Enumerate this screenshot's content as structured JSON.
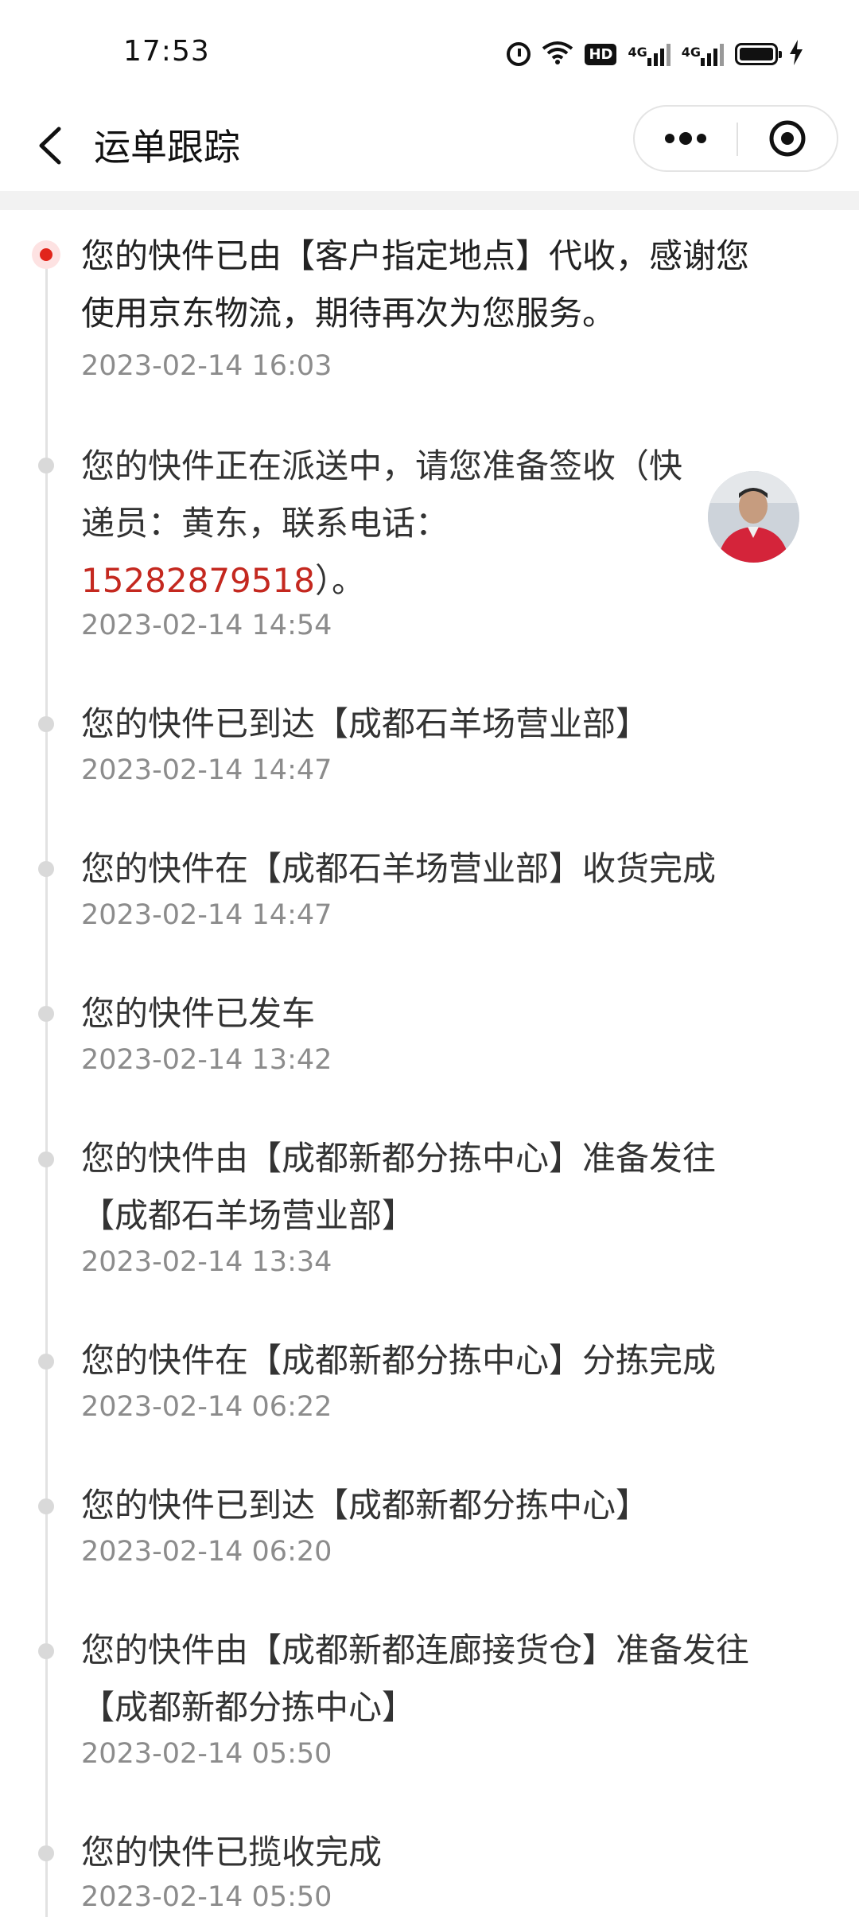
{
  "status_bar": {
    "time": "17:53",
    "hd_label": "HD",
    "network_1": "4G",
    "network_2": "4G",
    "icons": [
      "alarm-icon",
      "wifi-icon",
      "hd-badge",
      "signal-icon",
      "signal-icon",
      "battery-icon",
      "charging-icon"
    ]
  },
  "header": {
    "title": "运单跟踪",
    "more_icon": "more-dots-icon",
    "close_icon": "mini-program-close-icon"
  },
  "colors": {
    "accent": "#e1251b",
    "phone": "#c4281f",
    "text": "#333333",
    "time": "#8c8c8c"
  },
  "events": [
    {
      "text": "您的快件已由【客户指定地点】代收，感谢您使用京东物流，期待再次为您服务。",
      "time": "2023-02-14 16:03"
    },
    {
      "text_before": "您的快件正在派送中，请您准备签收（快递员：黄东，联系电话：",
      "phone": "15282879518",
      "text_after": "）。",
      "time": "2023-02-14 14:54"
    },
    {
      "text": "您的快件已到达【成都石羊场营业部】",
      "time": "2023-02-14 14:47"
    },
    {
      "text": "您的快件在【成都石羊场营业部】收货完成",
      "time": "2023-02-14 14:47"
    },
    {
      "text": "您的快件已发车",
      "time": "2023-02-14 13:42"
    },
    {
      "text": "您的快件由【成都新都分拣中心】准备发往【成都石羊场营业部】",
      "time": "2023-02-14 13:34"
    },
    {
      "text": "您的快件在【成都新都分拣中心】分拣完成",
      "time": "2023-02-14 06:22"
    },
    {
      "text": "您的快件已到达【成都新都分拣中心】",
      "time": "2023-02-14 06:20"
    },
    {
      "text": "您的快件由【成都新都连廊接货仓】准备发往【成都新都分拣中心】",
      "time": "2023-02-14 05:50"
    },
    {
      "text": "您的快件已揽收完成",
      "time": "2023-02-14 05:50"
    }
  ]
}
